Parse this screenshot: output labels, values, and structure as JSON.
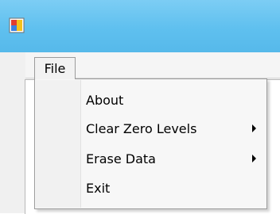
{
  "menubar": {
    "file_label": "File"
  },
  "file_menu": {
    "items": [
      {
        "label": "About",
        "has_submenu": false
      },
      {
        "label": "Clear Zero Levels",
        "has_submenu": true
      },
      {
        "label": "Erase Data",
        "has_submenu": true
      },
      {
        "label": "Exit",
        "has_submenu": false
      }
    ]
  },
  "icons": {
    "app_icon": "application-icon",
    "submenu_arrow": "chevron-right-icon"
  },
  "colors": {
    "title_bar": "#5fc0ef",
    "menu_background": "#f7f7f7",
    "menu_border": "#9b9b9b"
  }
}
